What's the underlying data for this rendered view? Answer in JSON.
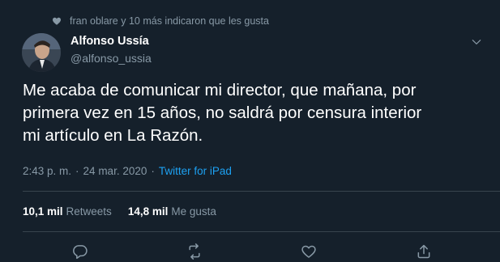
{
  "social_context": {
    "text": "fran oblare y 10 más indicaron que les gusta",
    "icon": "heart-icon"
  },
  "author": {
    "name": "Alfonso Ussía",
    "handle": "@alfonso_ussia",
    "avatar": "avatar-photo"
  },
  "tweet": {
    "text": "Me acaba de comunicar mi director, que mañana, por\nprimera vez en 15 años, no saldrá por censura interior\nmi artículo en La Razón."
  },
  "meta": {
    "time": "2:43 p. m.",
    "separator": "·",
    "date": "24 mar. 2020",
    "source": "Twitter for iPad"
  },
  "stats": {
    "retweets_count": "10,1 mil",
    "retweets_label": "Retweets",
    "likes_count": "14,8 mil",
    "likes_label": "Me gusta"
  },
  "actions": [
    "reply-icon",
    "retweet-icon",
    "like-icon",
    "share-icon"
  ],
  "colors": {
    "background": "#15202b",
    "text_primary": "#ffffff",
    "text_secondary": "#8899a6",
    "link": "#1da1f2",
    "divider": "#38444d"
  }
}
